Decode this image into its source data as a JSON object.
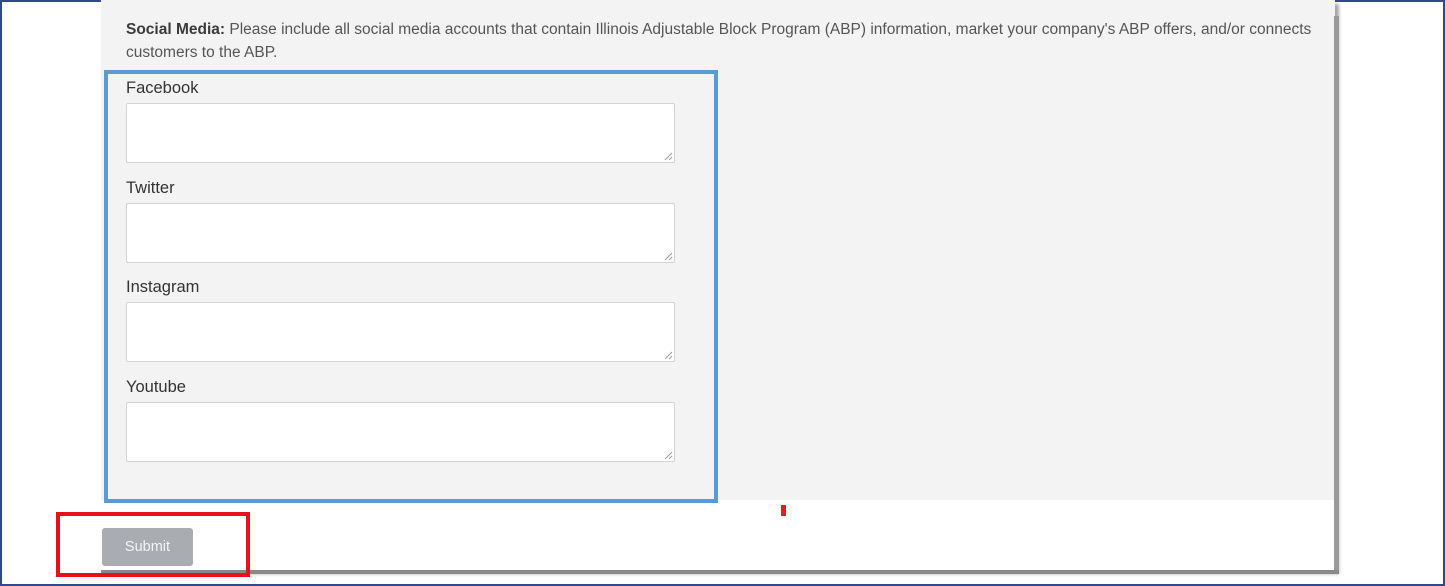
{
  "intro": {
    "label": "Social Media:",
    "text": " Please include all social media accounts that contain Illinois Adjustable Block Program (ABP) information, market your company's ABP offers, and/or connects customers to the ABP."
  },
  "fields": [
    {
      "label": "Facebook",
      "value": "",
      "placeholder": ""
    },
    {
      "label": "Twitter",
      "value": "",
      "placeholder": ""
    },
    {
      "label": "Instagram",
      "value": "",
      "placeholder": ""
    },
    {
      "label": "Youtube",
      "value": "",
      "placeholder": ""
    }
  ],
  "actions": {
    "submit_label": "Submit"
  },
  "colors": {
    "frame": "#2f4a86",
    "highlight_blue": "#5b9bd5",
    "highlight_red": "#e8101a",
    "button_bg": "#a9adb1",
    "panel_bg": "#f3f3f3"
  }
}
